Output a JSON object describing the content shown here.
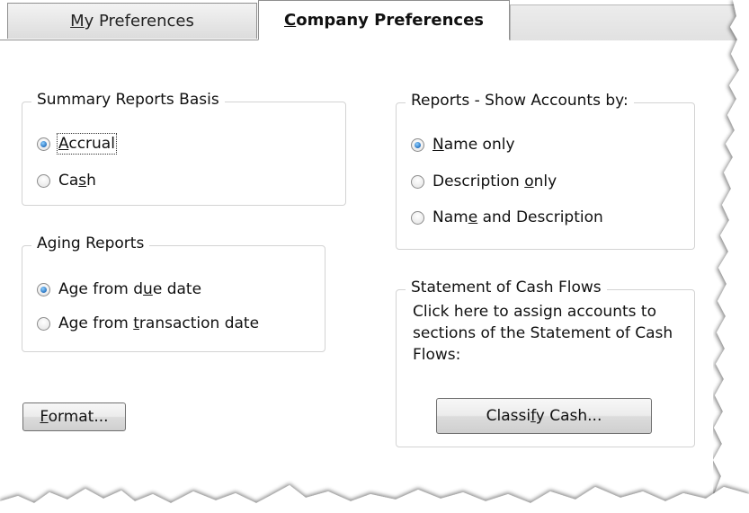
{
  "tabs": [
    {
      "label_pre": "",
      "label_u": "M",
      "label_post": "y Preferences",
      "active": false
    },
    {
      "label_pre": "",
      "label_u": "C",
      "label_post": "ompany Preferences",
      "active": true
    }
  ],
  "summary_basis": {
    "legend": "Summary Reports Basis",
    "options": [
      {
        "pre": "",
        "u": "A",
        "post": "ccrual",
        "checked": true
      },
      {
        "pre": "Ca",
        "u": "s",
        "post": "h",
        "checked": false
      }
    ]
  },
  "aging": {
    "legend": "Aging Reports",
    "options": [
      {
        "pre": "Age from d",
        "u": "u",
        "post": "e date",
        "checked": true
      },
      {
        "pre": "Age from ",
        "u": "t",
        "post": "ransaction date",
        "checked": false
      }
    ]
  },
  "accounts_by": {
    "legend": "Reports - Show Accounts by:",
    "options": [
      {
        "pre": "",
        "u": "N",
        "post": "ame only",
        "checked": true
      },
      {
        "pre": "Description ",
        "u": "o",
        "post": "nly",
        "checked": false
      },
      {
        "pre": "Nam",
        "u": "e",
        "post": " and Description",
        "checked": false
      }
    ]
  },
  "cash_flows": {
    "legend": "Statement of Cash Flows",
    "description": "Click here to assign accounts to sections of the Statement of Cash Flows:",
    "button": {
      "pre": "Classi",
      "u": "f",
      "post": "y Cash..."
    }
  },
  "format_button": {
    "pre": "",
    "u": "F",
    "post": "ormat..."
  },
  "colors": {
    "radio_checked": "#1b67b8",
    "border": "#d3d3d3",
    "tab_bg": "#dcdcdc"
  }
}
